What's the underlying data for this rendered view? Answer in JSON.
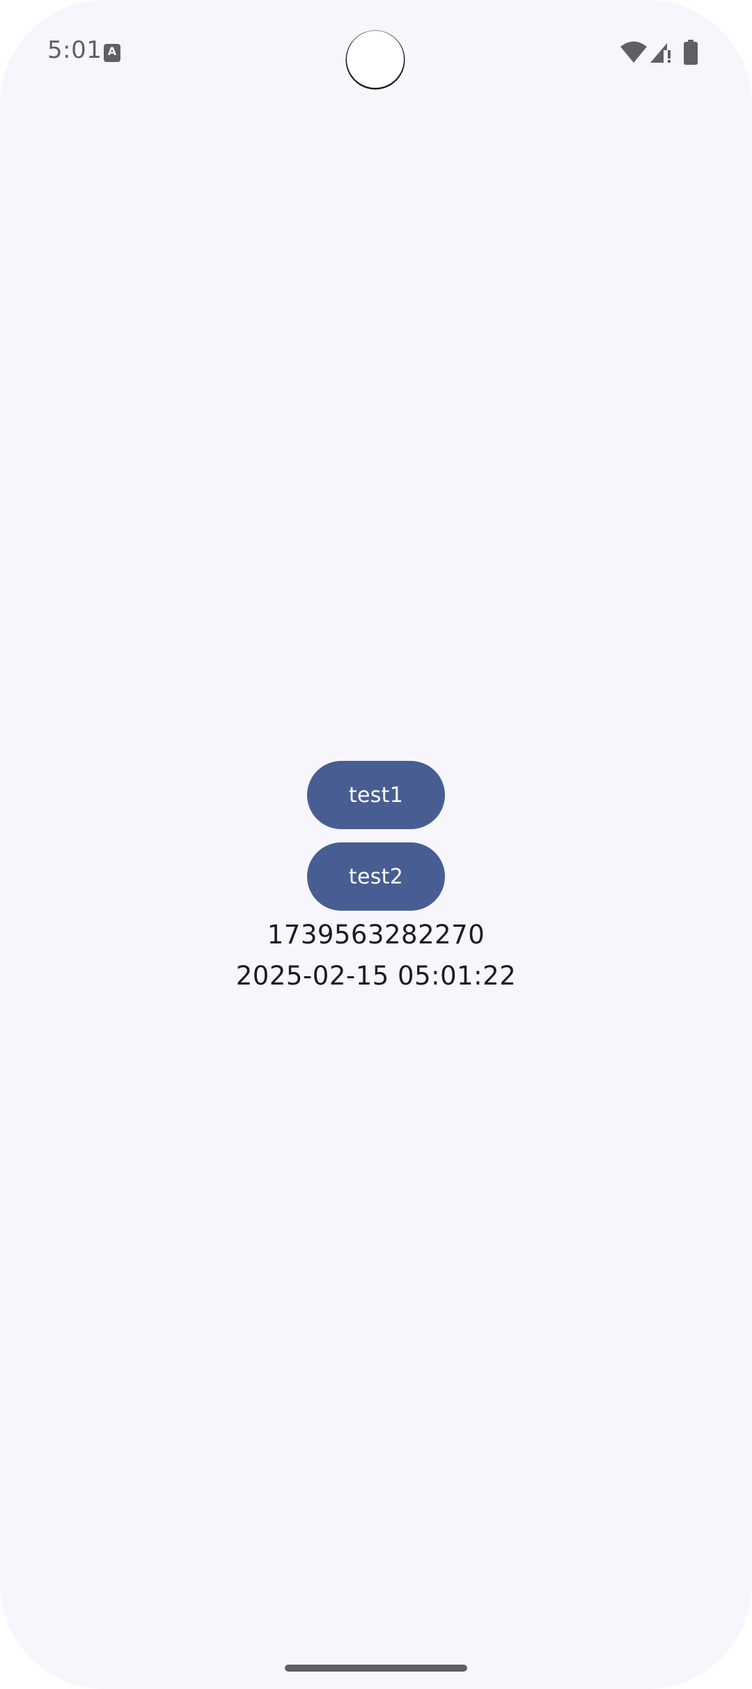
{
  "status_bar": {
    "time": "5:01",
    "notification_icon_letter": "A",
    "icons": [
      "wifi-icon",
      "signal-icon",
      "battery-icon"
    ],
    "icon_color": "#5f5f66"
  },
  "main": {
    "buttons": [
      {
        "label": "test1"
      },
      {
        "label": "test2"
      }
    ],
    "timestamp_ms": "1739563282270",
    "datetime": "2025-02-15 05:01:22"
  },
  "colors": {
    "background": "#f7f6fc",
    "button": "#485d92",
    "button_text": "#ffffff",
    "text": "#1b1b21"
  }
}
